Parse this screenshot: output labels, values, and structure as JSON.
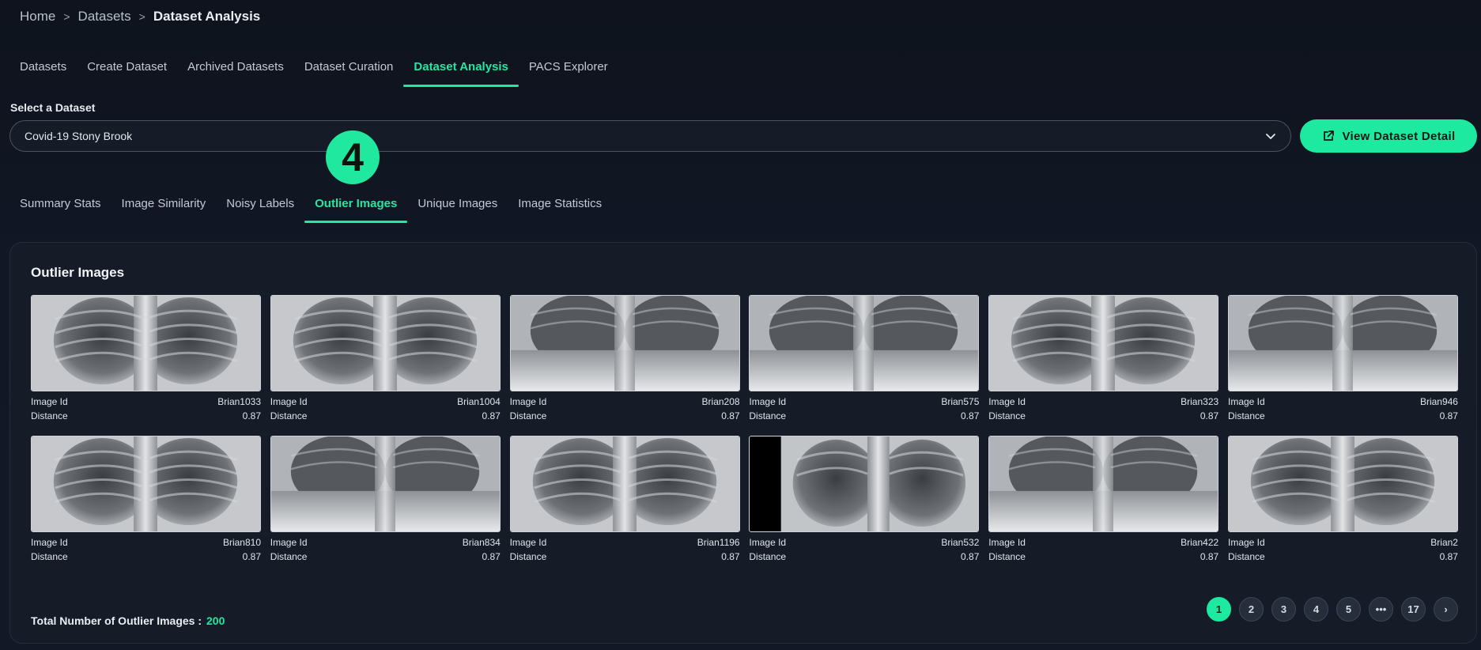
{
  "breadcrumb": {
    "home": "Home",
    "datasets": "Datasets",
    "current": "Dataset Analysis",
    "sep": ">"
  },
  "nav_tabs": [
    {
      "label": "Datasets"
    },
    {
      "label": "Create Dataset"
    },
    {
      "label": "Archived Datasets"
    },
    {
      "label": "Dataset Curation"
    },
    {
      "label": "Dataset Analysis",
      "active": true
    },
    {
      "label": "PACS Explorer"
    }
  ],
  "select": {
    "label": "Select a Dataset",
    "value": "Covid-19 Stony Brook"
  },
  "view_button": {
    "label": "View Dataset Detail"
  },
  "step_badge": {
    "label": "4"
  },
  "sub_tabs": [
    {
      "label": "Summary Stats"
    },
    {
      "label": "Image Similarity"
    },
    {
      "label": "Noisy Labels"
    },
    {
      "label": "Outlier Images",
      "active": true
    },
    {
      "label": "Unique Images"
    },
    {
      "label": "Image Statistics"
    }
  ],
  "card": {
    "title": "Outlier Images",
    "id_label": "Image Id",
    "distance_label": "Distance",
    "images": [
      {
        "id": "Brian1033",
        "distance": "0.87"
      },
      {
        "id": "Brian1004",
        "distance": "0.87"
      },
      {
        "id": "Brian208",
        "distance": "0.87"
      },
      {
        "id": "Brian575",
        "distance": "0.87"
      },
      {
        "id": "Brian323",
        "distance": "0.87"
      },
      {
        "id": "Brian946",
        "distance": "0.87"
      },
      {
        "id": "Brian810",
        "distance": "0.87"
      },
      {
        "id": "Brian834",
        "distance": "0.87"
      },
      {
        "id": "Brian1196",
        "distance": "0.87"
      },
      {
        "id": "Brian532",
        "distance": "0.87"
      },
      {
        "id": "Brian422",
        "distance": "0.87"
      },
      {
        "id": "Brian2",
        "distance": "0.87"
      }
    ],
    "total_label": "Total Number of Outlier Images :",
    "total_value": "200"
  },
  "pagination": {
    "pages": [
      "1",
      "2",
      "3",
      "4",
      "5",
      "•••",
      "17"
    ],
    "active": "1",
    "next": "›"
  },
  "colors": {
    "accent": "#1de9a0",
    "background": "#101622",
    "card": "#161c27"
  }
}
